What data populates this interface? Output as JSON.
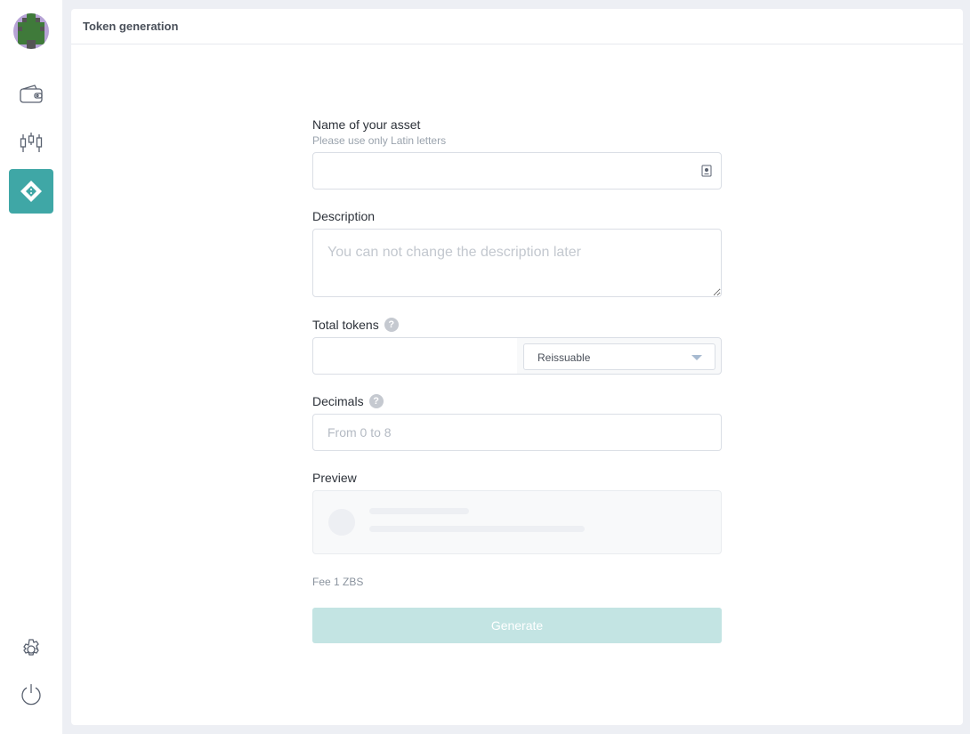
{
  "sidebar": {
    "items": [
      {
        "icon": "wallet-icon"
      },
      {
        "icon": "candlestick-chart-icon"
      },
      {
        "icon": "token-icon",
        "active": true
      },
      {
        "icon": "gear-icon"
      },
      {
        "icon": "power-icon"
      }
    ],
    "accent": "#3fa7a6"
  },
  "header": {
    "title": "Token generation"
  },
  "form": {
    "name": {
      "label": "Name of your asset",
      "hint": "Please use only Latin letters",
      "value": ""
    },
    "description": {
      "label": "Description",
      "placeholder": "You can not change the description later"
    },
    "total": {
      "label": "Total tokens",
      "help": "?",
      "select": "Reissuable"
    },
    "decimals": {
      "label": "Decimals",
      "help": "?",
      "placeholder": "From 0 to 8"
    },
    "preview": {
      "label": "Preview"
    },
    "fee": "Fee 1 ZBS",
    "generate": "Generate"
  }
}
